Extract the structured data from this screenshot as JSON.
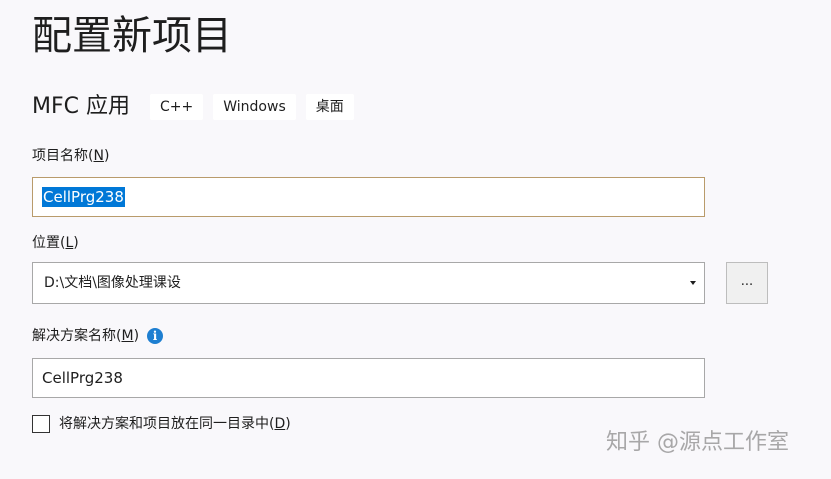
{
  "page_title": "配置新项目",
  "template": {
    "name": "MFC 应用",
    "tags": [
      "C++",
      "Windows",
      "桌面"
    ]
  },
  "project_name": {
    "label": "项目名称(",
    "hotkey": "N",
    "label_end": ")",
    "value": "CellPrg238"
  },
  "location": {
    "label": "位置(",
    "hotkey": "L",
    "label_end": ")",
    "value": "D:\\文档\\图像处理课设",
    "browse_label": "..."
  },
  "solution_name": {
    "label": "解决方案名称(",
    "hotkey": "M",
    "label_end": ")",
    "info_glyph": "i",
    "value": "CellPrg238"
  },
  "same_directory": {
    "label": "将解决方案和项目放在同一目录中(",
    "hotkey": "D",
    "label_end": ")",
    "checked": false
  },
  "watermark": "知乎 @源点工作室",
  "colors": {
    "selection": "#0078d7",
    "focus_border": "#b99b6b",
    "info": "#1e7fd1"
  }
}
